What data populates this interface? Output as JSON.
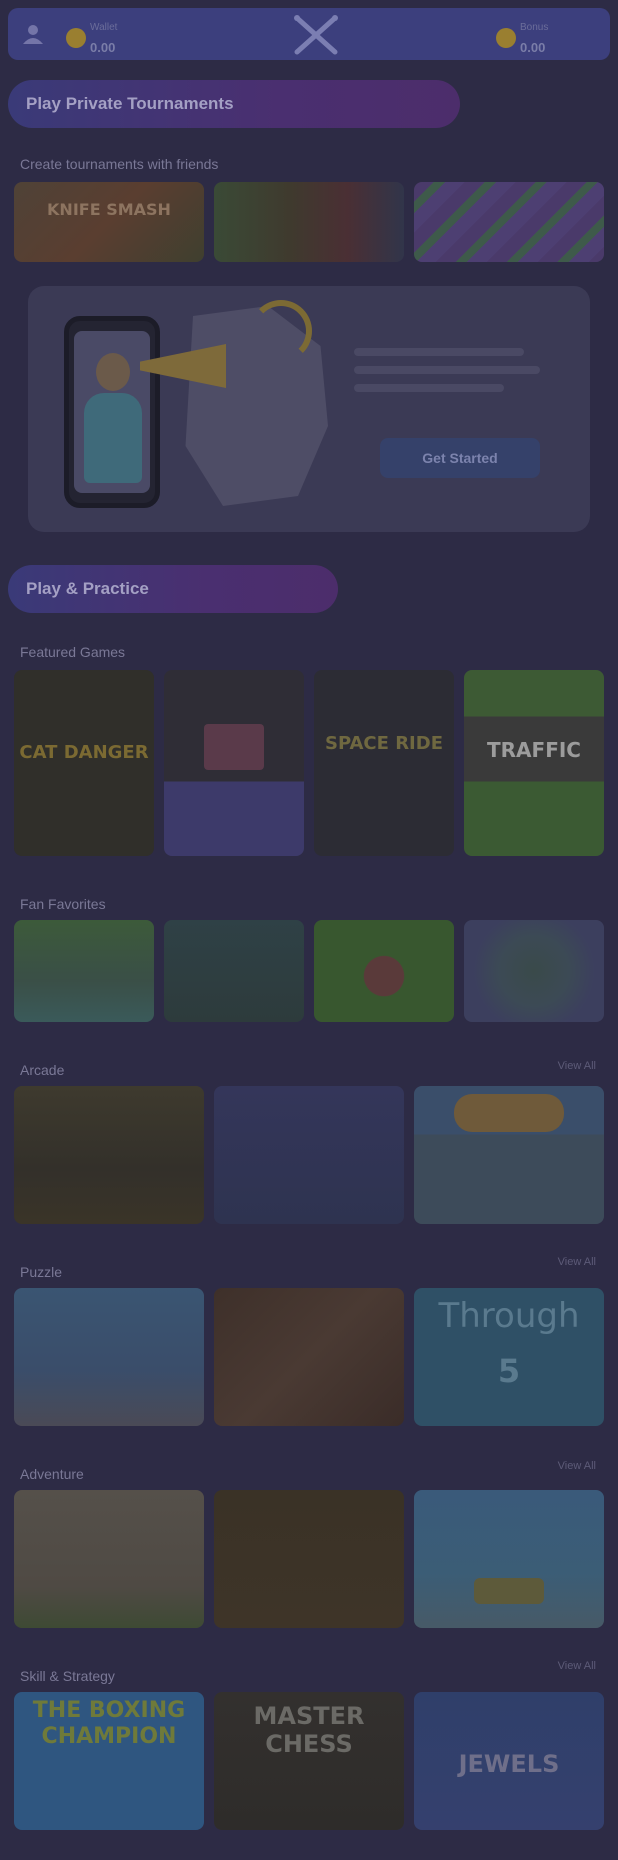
{
  "header": {
    "menu_icon": "user-icon",
    "left_coin_label": "Wallet",
    "left_coin_value": "0.00",
    "logo_icon": "crossed-sticks-logo",
    "right_coin_label": "Bonus",
    "right_coin_value": "0.00"
  },
  "banners": [
    {
      "label": "Play Private Tournaments"
    },
    {
      "label": "Play & Practice"
    }
  ],
  "private_section_title": "Create tournaments with friends",
  "promo": {
    "cta_label": "Get Started",
    "icon": "megaphone-man-illustration"
  },
  "sections": [
    {
      "title": "Featured Games",
      "view_all": ""
    },
    {
      "title": "Fan Favorites",
      "view_all": ""
    },
    {
      "title": "Arcade",
      "view_all": "View All"
    },
    {
      "title": "Puzzle",
      "view_all": "View All"
    },
    {
      "title": "Adventure",
      "view_all": "View All"
    },
    {
      "title": "Skill & Strategy",
      "view_all": "View All"
    }
  ],
  "game_tiles": {
    "private_1": "KNIFE SMASH",
    "private_2": "",
    "private_3": "",
    "featured_1": "CAT DANGER",
    "featured_2": "",
    "featured_3": "SPACE RIDE",
    "featured_4": "TRAFFIC",
    "puzzle_3": "Through",
    "puzzle_3_sub": "5",
    "skill_1": "THE BOXING CHAMPION",
    "skill_2": "MASTER CHESS",
    "skill_3": "JEWELS"
  },
  "colors": {
    "background": "#2d2b45",
    "header": "#3c3f7d",
    "banner_start": "#3a3a78",
    "banner_end": "#4c2d6b",
    "coin": "#9a7f30"
  }
}
